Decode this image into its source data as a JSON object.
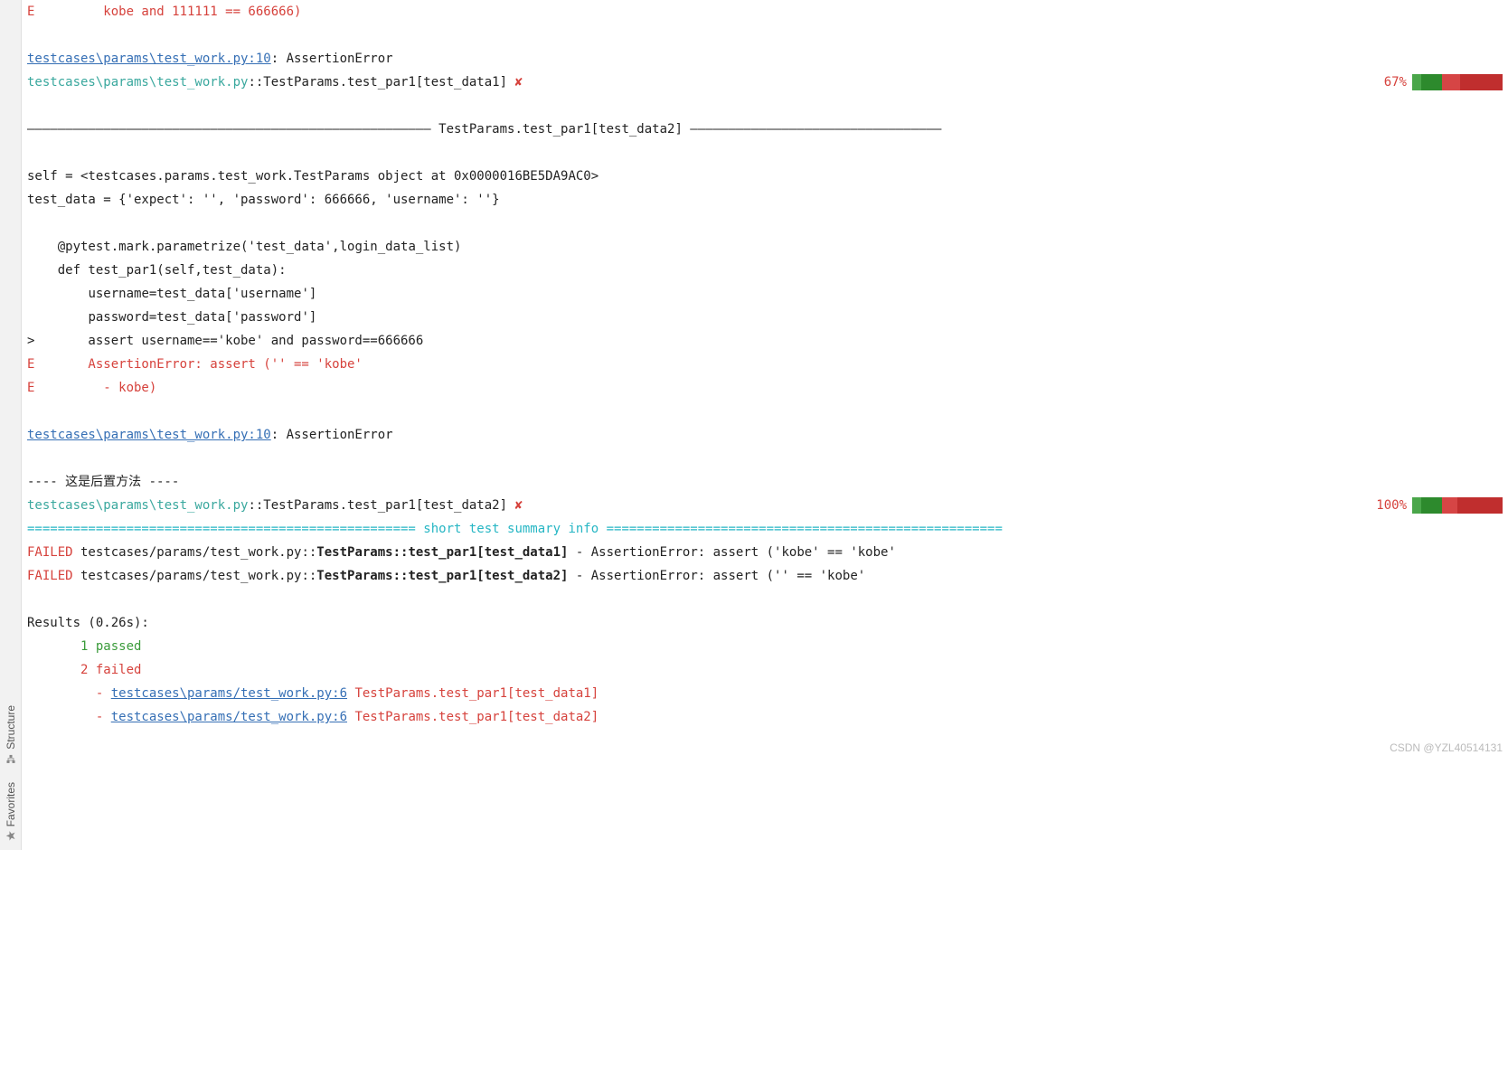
{
  "sidebar": {
    "favorites_label": "Favorites",
    "structure_label": "Structure"
  },
  "lines": {
    "l1": "E         kobe and 111111 == 666666)",
    "l2_link": "testcases\\params\\test_work.py:10",
    "l2_rest": ": AssertionError",
    "l3_path": " testcases\\params\\test_work.py",
    "l3_sep": "::",
    "l3_test": "TestParams.test_par1[test_data1]",
    "l3_x": " ✘",
    "l3_pct": "67%",
    "l4": "――――――――――――――――――――――――――――――――――――――――――――――――――――― TestParams.test_par1[test_data2] ―――――――――――――――――――――――――――――――――",
    "l5": "self = <testcases.params.test_work.TestParams object at 0x0000016BE5DA9AC0>",
    "l6": "test_data = {'expect': '', 'password': 666666, 'username': ''}",
    "l7": "    @pytest.mark.parametrize('test_data',login_data_list)",
    "l8": "    def test_par1(self,test_data):",
    "l9": "        username=test_data['username']",
    "l10": "        password=test_data['password']",
    "l11": ">       assert username=='kobe' and password==666666",
    "l12": "E       AssertionError: assert ('' == 'kobe'",
    "l13": "E         - kobe)",
    "l14_link": "testcases\\params\\test_work.py:10",
    "l14_rest": ": AssertionError",
    "l15": "---- 这是后置方法 ----",
    "l16_path": " testcases\\params\\test_work.py",
    "l16_sep": "::",
    "l16_test": "TestParams.test_par1[test_data2]",
    "l16_x": " ✘",
    "l16_pct": "100%",
    "summary_divider": "=================================================== short test summary info ====================================================",
    "fail1_pre": "FAILED",
    "fail1_mid": " testcases/params/test_work.py::",
    "fail1_bold": "TestParams::test_par1[test_data1]",
    "fail1_post": " - AssertionError: assert ('kobe' == 'kobe'",
    "fail2_pre": "FAILED",
    "fail2_mid": " testcases/params/test_work.py::",
    "fail2_bold": "TestParams::test_par1[test_data2]",
    "fail2_post": " - AssertionError: assert ('' == 'kobe'",
    "results_header": "Results (0.26s):",
    "results_passed": "       1 passed",
    "results_failed": "       2 failed",
    "results_f1_dash": "         - ",
    "results_f1_link": "testcases\\params/test_work.py:6",
    "results_f1_name": " TestParams.test_par1[test_data1]",
    "results_f2_dash": "         - ",
    "results_f2_link": "testcases\\params/test_work.py:6",
    "results_f2_name": " TestParams.test_par1[test_data2]"
  },
  "watermark": "CSDN @YZL40514131"
}
